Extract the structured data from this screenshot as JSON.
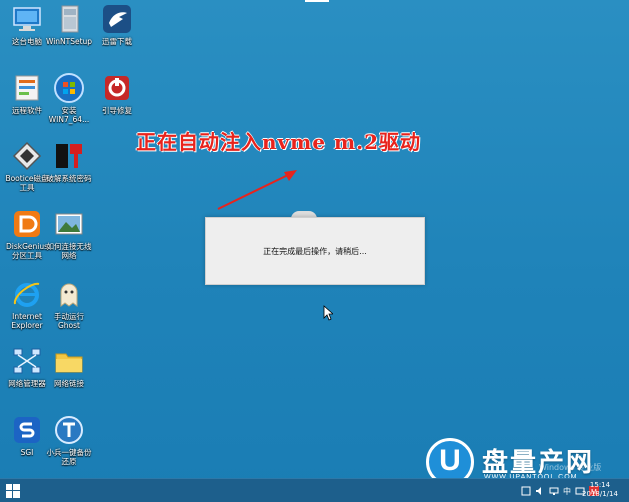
{
  "desktop_icons": [
    {
      "id": "this-pc",
      "label": "这台电脑"
    },
    {
      "id": "winntsetup",
      "label": "WinNTSetup"
    },
    {
      "id": "thunder",
      "label": "迅雷下载"
    },
    {
      "id": "remote",
      "label": "远程软件"
    },
    {
      "id": "install-win7",
      "label": "安装\nWIN7_64..."
    },
    {
      "id": "boot-repair",
      "label": "引导修复"
    },
    {
      "id": "bootice",
      "label": "Bootice磁盘\n工具"
    },
    {
      "id": "ntpwedit",
      "label": "破解系统密码"
    },
    {
      "id": "diskgenius",
      "label": "DiskGenius\n分区工具"
    },
    {
      "id": "wireless",
      "label": "如何连接无线\n网络"
    },
    {
      "id": "ie",
      "label": "Internet\nExplorer"
    },
    {
      "id": "ghost",
      "label": "手动运行\nGhost"
    },
    {
      "id": "net-manager",
      "label": "网络管理器"
    },
    {
      "id": "net-link",
      "label": "网络链接"
    },
    {
      "id": "sgi",
      "label": "SGI"
    },
    {
      "id": "one-key-restore",
      "label": "小兵一键备份\n还原"
    }
  ],
  "annotation": {
    "text": "正在自动注入nvme m.2驱动"
  },
  "dialog": {
    "message": "正在完成最后操作，请稍后..."
  },
  "taskbar": {
    "clock_time": "15:14",
    "clock_date": "2018/1/14",
    "input_lang": "中"
  },
  "watermark": {
    "text": "Windows 专业版"
  },
  "logo": {
    "letter": "U",
    "brand": "盘量产网",
    "sub": "WWW.UPANTOOL.COM"
  },
  "colors": {
    "desktop": "#2a8fc2",
    "taskbar": "#1d5f8c",
    "annotation": "#e8231c"
  }
}
